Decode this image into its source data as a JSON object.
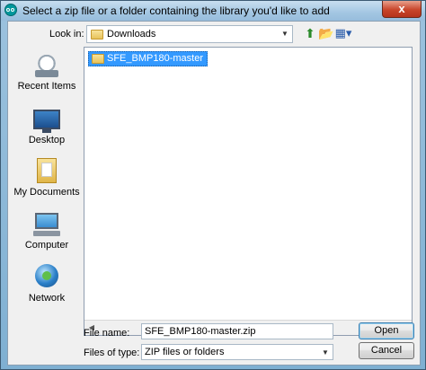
{
  "dialog": {
    "title": "Select a zip file or a folder containing the library you'd like to add",
    "close_label": "x"
  },
  "toolbar": {
    "look_in_label": "Look in:",
    "look_in_value": "Downloads"
  },
  "places": [
    {
      "label": "Recent Items",
      "icon": "recent-items-icon"
    },
    {
      "label": "Desktop",
      "icon": "desktop-icon"
    },
    {
      "label": "My Documents",
      "icon": "my-documents-icon"
    },
    {
      "label": "Computer",
      "icon": "computer-icon"
    },
    {
      "label": "Network",
      "icon": "network-icon"
    }
  ],
  "files": [
    {
      "name": "SFE_BMP180-master",
      "type": "folder",
      "selected": true
    }
  ],
  "form": {
    "file_name_label": "File name:",
    "file_name_value": "SFE_BMP180-master.zip",
    "files_of_type_label": "Files of type:",
    "files_of_type_value": "ZIP files or folders"
  },
  "buttons": {
    "open_label": "Open",
    "cancel_label": "Cancel"
  }
}
